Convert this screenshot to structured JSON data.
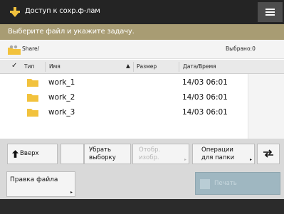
{
  "titlebar": {
    "title": "Доступ к сохр.ф-лам",
    "menu_icon": "hamburger-menu-icon",
    "app_icon": "storage-access-icon"
  },
  "banner": {
    "text": "Выберите файл и укажите задачу."
  },
  "path": {
    "current": "Share/",
    "selected_label": "Выбрано:0",
    "icon": "shared-folder-icon"
  },
  "table": {
    "columns": {
      "type": "Тип",
      "name": "Имя",
      "sort_arrow": "▲",
      "size": "Размер",
      "datetime": "Дата/Время"
    },
    "rows": [
      {
        "name": "work_1",
        "date": "14/03  06:01",
        "icon": "folder-icon"
      },
      {
        "name": "work_2",
        "date": "14/03  06:01",
        "icon": "folder-icon"
      },
      {
        "name": "work_3",
        "date": "14/03  06:01",
        "icon": "folder-icon"
      }
    ]
  },
  "toolbar": {
    "up_label": "Вверх",
    "clear_label": "Убрать\nвыборку",
    "show_image_label": "Отобр.\nизобр.",
    "folder_ops_label": "Операции\nдля папки",
    "refresh_icon": "refresh-icon"
  },
  "bottom": {
    "edit_label": "Правка файла",
    "start_label": "Печать"
  },
  "colors": {
    "titlebar": "#242424",
    "banner": "#a89c73",
    "toolbar": "#d9d9d9",
    "folder": "#f2c23d",
    "start": "#9fb7c1"
  }
}
